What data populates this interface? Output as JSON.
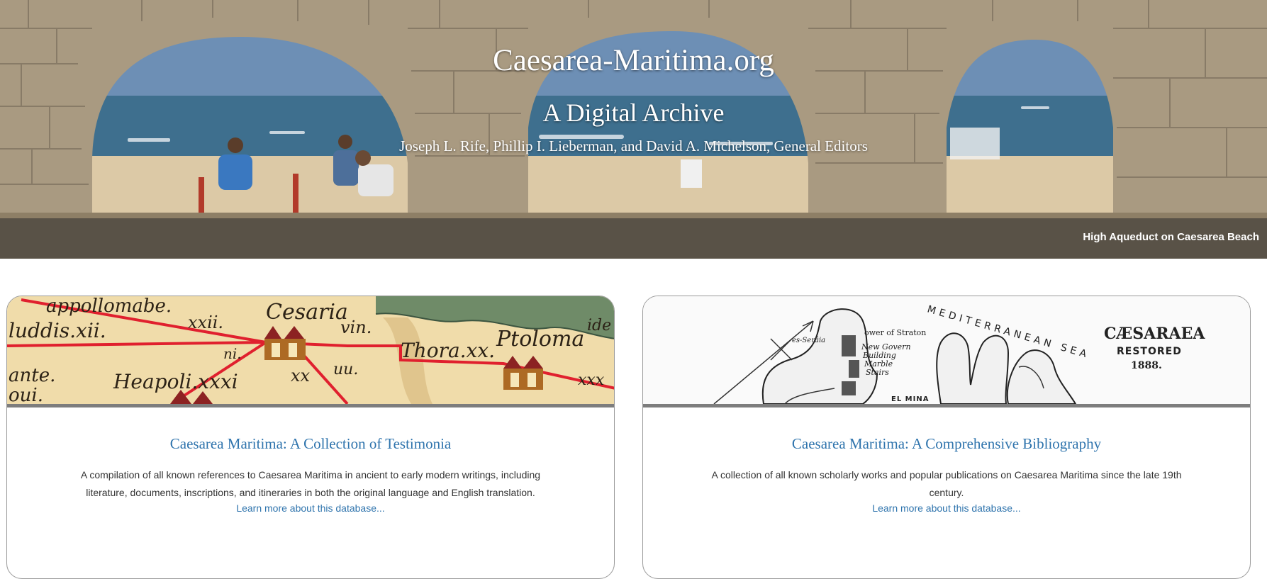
{
  "hero": {
    "title": "Caesarea-Maritima.org",
    "subtitle": "A Digital Archive",
    "editors": "Joseph L. Rife, Phillip I. Lieberman, and David A. Michelson, General Editors",
    "caption": "High Aqueduct on Caesarea Beach"
  },
  "cards": [
    {
      "title": "Caesarea Maritima: A Collection of Testimonia",
      "description": "A compilation of all known references to Caesarea Maritima in ancient to early modern writings, including literature, documents, inscriptions, and itineraries in both the original language and English translation.",
      "link": "Learn more about this database...",
      "image_text": {
        "l1": "appollomabe.",
        "l2": "xxii.",
        "l3": "Cesaria",
        "l4": "luddis.xii.",
        "l5": "vin.",
        "l6": "ni.",
        "l7": "Thora.xx.",
        "l8": "Ptoloma",
        "l9": "ide",
        "l10": "ante.",
        "l11": "oui.",
        "l12": "Heapoli.xxxi",
        "l13": "xx",
        "l14": "uu.",
        "l15": "xxx"
      }
    },
    {
      "title": "Caesarea Maritima: A Comprehensive Bibliography",
      "description": "A collection of all known scholarly works and popular publications on Caesarea Maritima since the late 19th century.",
      "link": "Learn more about this database...",
      "image_text": {
        "sea": "MEDITERRANEAN SEA",
        "main1": "CÆSARAEA",
        "main2": "RESTORED",
        "year": "1888.",
        "tower": "ower of Straton",
        "serail": "es-Serâia",
        "gov": "New Govern",
        "building": "Building",
        "marble": "Marble",
        "stairs": "Stairs",
        "mina": "EL MINA"
      }
    }
  ]
}
